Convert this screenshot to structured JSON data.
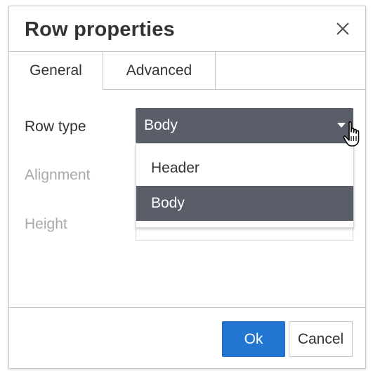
{
  "dialog": {
    "title": "Row properties",
    "close_icon": "close-icon"
  },
  "tabs": [
    {
      "label": "General",
      "active": true
    },
    {
      "label": "Advanced",
      "active": false
    }
  ],
  "form": {
    "row_type_label": "Row type",
    "row_type_value": "Body",
    "alignment_label": "Alignment",
    "height_label": "Height"
  },
  "dropdown": {
    "options": [
      {
        "label": "Header",
        "selected": false
      },
      {
        "label": "Body",
        "selected": true
      }
    ]
  },
  "footer": {
    "ok_label": "Ok",
    "cancel_label": "Cancel"
  },
  "colors": {
    "accent": "#2276d2",
    "select_bg": "#595e69",
    "disabled_text": "#a9a9a9"
  },
  "cursor_icon": "hand-pointer-icon"
}
